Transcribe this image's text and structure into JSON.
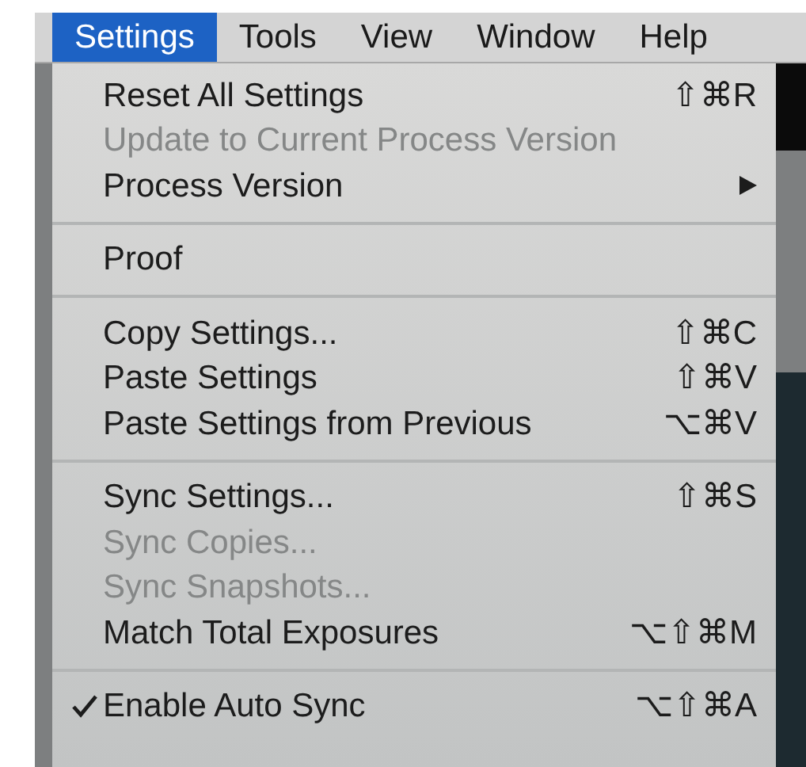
{
  "menu_bar": [
    {
      "label": "Settings",
      "selected": true
    },
    {
      "label": "Tools",
      "selected": false
    },
    {
      "label": "View",
      "selected": false
    },
    {
      "label": "Window",
      "selected": false
    },
    {
      "label": "Help",
      "selected": false
    }
  ],
  "menu": {
    "sections": [
      [
        {
          "label": "Reset All Settings",
          "shortcut": "⇧⌘R",
          "disabled": false,
          "checked": false,
          "submenu": false
        },
        {
          "label": "Update to Current Process Version",
          "disabled": true,
          "checked": false,
          "submenu": false
        },
        {
          "label": "Process Version",
          "disabled": false,
          "checked": false,
          "submenu": true
        }
      ],
      [
        {
          "label": "Proof",
          "disabled": false,
          "checked": false,
          "submenu": false
        }
      ],
      [
        {
          "label": "Copy Settings...",
          "shortcut": "⇧⌘C",
          "disabled": false,
          "checked": false,
          "submenu": false
        },
        {
          "label": "Paste Settings",
          "shortcut": "⇧⌘V",
          "disabled": false,
          "checked": false,
          "submenu": false
        },
        {
          "label": "Paste Settings from Previous",
          "shortcut": "⌥⌘V",
          "disabled": false,
          "checked": false,
          "submenu": false
        }
      ],
      [
        {
          "label": "Sync Settings...",
          "shortcut": "⇧⌘S",
          "disabled": false,
          "checked": false,
          "submenu": false
        },
        {
          "label": "Sync Copies...",
          "disabled": true,
          "checked": false,
          "submenu": false
        },
        {
          "label": "Sync Snapshots...",
          "disabled": true,
          "checked": false,
          "submenu": false
        },
        {
          "label": "Match Total Exposures",
          "shortcut": "⌥⇧⌘M",
          "disabled": false,
          "checked": false,
          "submenu": false
        }
      ],
      [
        {
          "label": "Enable Auto Sync",
          "shortcut": "⌥⇧⌘A",
          "disabled": false,
          "checked": true,
          "submenu": false
        }
      ]
    ]
  }
}
